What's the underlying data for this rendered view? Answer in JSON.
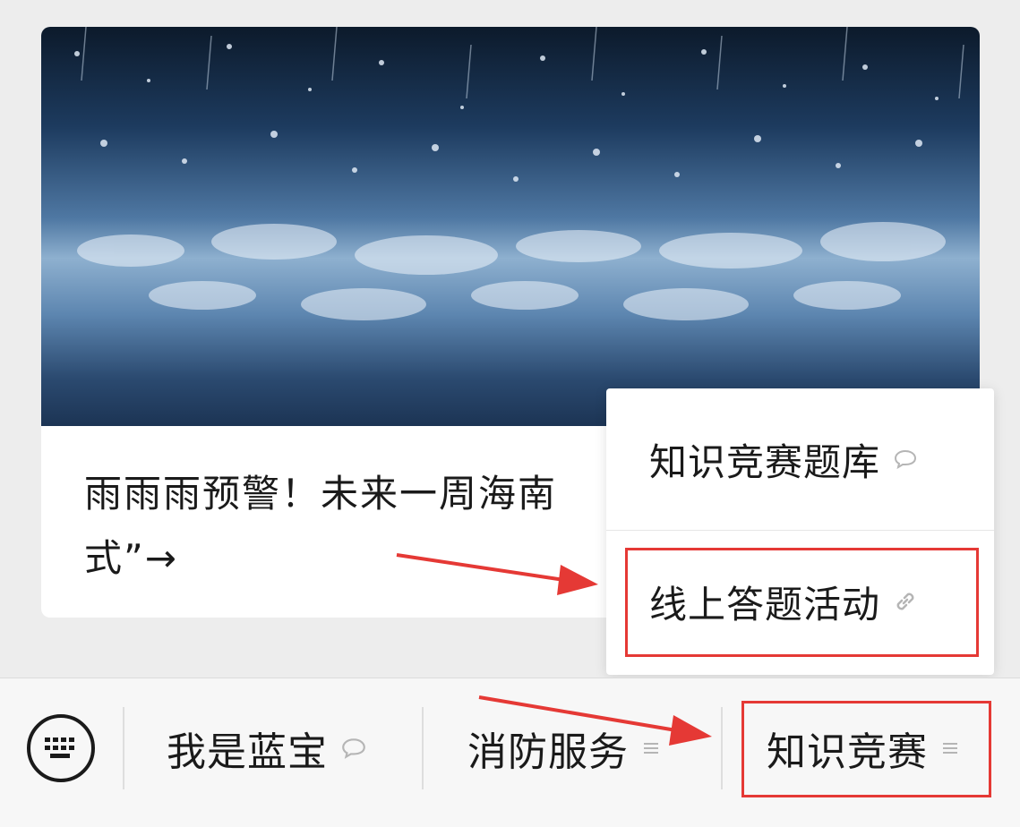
{
  "article": {
    "title": "雨雨雨预警！未来一周海南",
    "title_line2": "式”→"
  },
  "popup": {
    "items": [
      {
        "label": "知识竞赛题库",
        "icon": "chat-bubble-icon"
      },
      {
        "label": "线上答题活动",
        "icon": "link-icon"
      }
    ]
  },
  "menu": {
    "keyboard_icon": "keyboard-icon",
    "items": [
      {
        "label": "我是蓝宝",
        "icon": "chat-bubble-icon"
      },
      {
        "label": "消防服务",
        "icon": "menu-lines-icon"
      },
      {
        "label": "知识竞赛",
        "icon": "menu-lines-icon"
      }
    ]
  },
  "colors": {
    "highlight": "#e53935",
    "background": "#ededed",
    "text": "#1a1a1a"
  }
}
